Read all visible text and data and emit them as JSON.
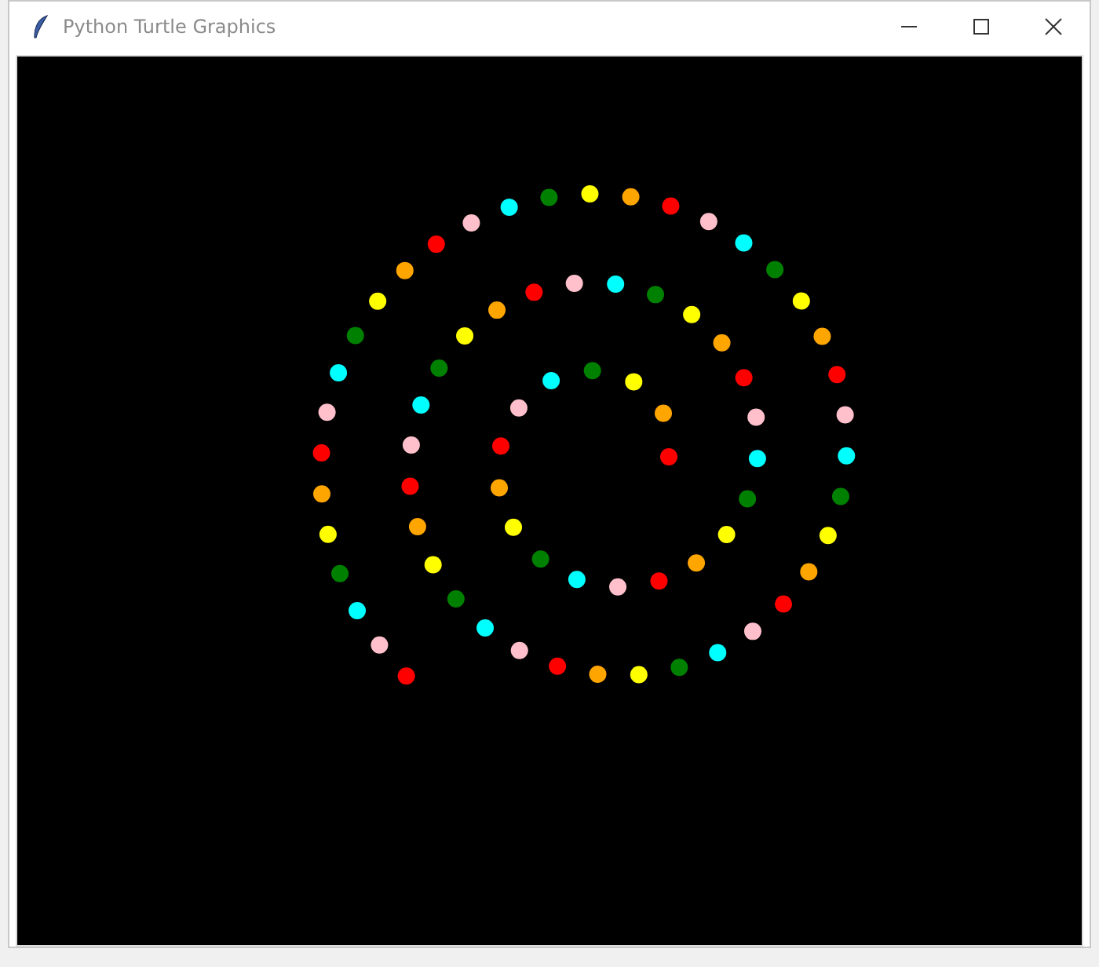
{
  "window": {
    "title": "Python Turtle Graphics"
  },
  "canvas": {
    "kind": "turtle-drawing"
  }
}
